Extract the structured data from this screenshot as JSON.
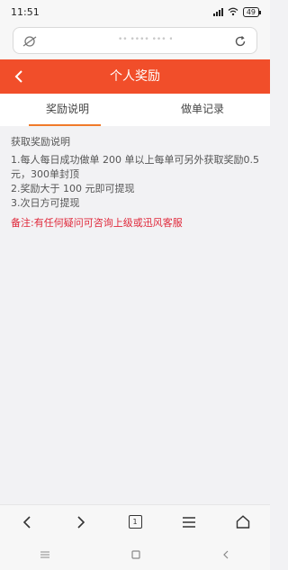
{
  "status_bar": {
    "time": "11:51",
    "battery": "49"
  },
  "header": {
    "title": "个人奖励"
  },
  "tabs": [
    {
      "label": "奖励说明",
      "active": true
    },
    {
      "label": "做单记录",
      "active": false
    }
  ],
  "content": {
    "heading": "获取奖励说明",
    "rule1": "1.每人每日成功做单 200 单以上每单可另外获取奖励0.5元，300单封顶",
    "rule2": "2.奖励大于 100 元即可提现",
    "rule3": "3.次日方可提现",
    "note": "备注:有任何疑问可咨询上级或迅风客服"
  },
  "bottom_nav": {
    "tab_count": "1"
  },
  "colors": {
    "accent": "#f14e2a",
    "note": "#e0283a",
    "tab_underline": "#f07a2a"
  }
}
